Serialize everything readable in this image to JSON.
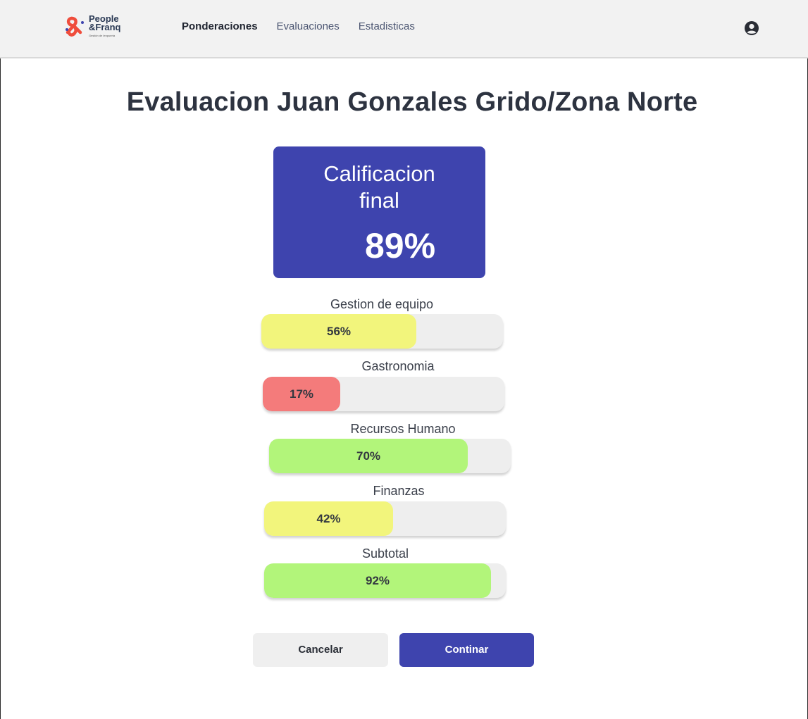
{
  "header": {
    "brand": {
      "line1": "People",
      "line2": "&Franq",
      "tagline": "Gestión de lenpuerta"
    },
    "nav": [
      {
        "label": "Ponderaciones",
        "active": true
      },
      {
        "label": "Evaluaciones",
        "active": false
      },
      {
        "label": "Estadisticas",
        "active": false
      }
    ],
    "user_icon": "user-circle-icon"
  },
  "page": {
    "title": "Evaluacion Juan Gonzales Grido/Zona Norte"
  },
  "final_score": {
    "label_line1": "Calificacion",
    "label_line2": "final",
    "value": "89%",
    "color": "#3e44ae"
  },
  "metrics": [
    {
      "label": "Gestion de equipo",
      "value": "56%",
      "fraction": 0.64,
      "color": "#f2f57c"
    },
    {
      "label": "Gastronomia",
      "value": "17%",
      "fraction": 0.32,
      "color": "#f47b7b"
    },
    {
      "label": "Recursos Humano",
      "value": "70%",
      "fraction": 0.823,
      "color": "#b2f57a"
    },
    {
      "label": "Finanzas",
      "value": "42%",
      "fraction": 0.534,
      "color": "#f2f57c"
    },
    {
      "label": "Subtotal",
      "value": "92%",
      "fraction": 0.94,
      "color": "#b2f57a"
    }
  ],
  "actions": {
    "cancel_label": "Cancelar",
    "continue_label": "Continar"
  }
}
